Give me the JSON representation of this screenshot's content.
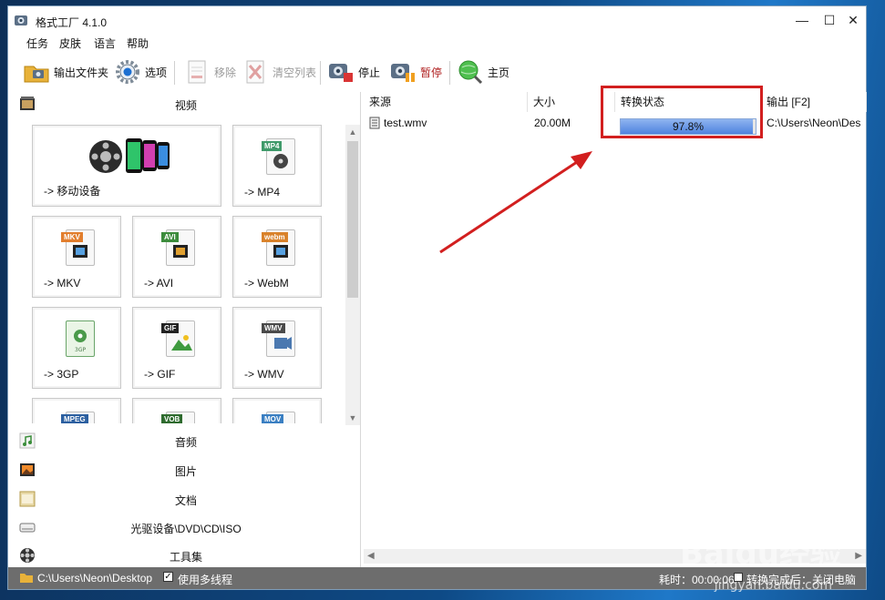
{
  "window": {
    "title": "格式工厂 4.1.0"
  },
  "menu": [
    "任务",
    "皮肤",
    "语言",
    "帮助"
  ],
  "toolbar": {
    "output_folder": "输出文件夹",
    "options": "选项",
    "remove": "移除",
    "clear_list": "清空列表",
    "stop": "停止",
    "pause": "暂停",
    "home": "主页"
  },
  "categories": {
    "video": "视频",
    "audio": "音频",
    "image": "图片",
    "document": "文档",
    "rom": "光驱设备\\DVD\\CD\\ISO",
    "tools": "工具集"
  },
  "video_tiles": [
    {
      "label": "-> 移动设备"
    },
    {
      "label": "-> MP4",
      "tag": "MP4"
    },
    {
      "label": "-> MKV",
      "tag": "MKV"
    },
    {
      "label": "-> AVI",
      "tag": "AVI"
    },
    {
      "label": "-> WebM",
      "tag": "webm"
    },
    {
      "label": "-> 3GP",
      "tag": "3GP"
    },
    {
      "label": "-> GIF",
      "tag": "GIF"
    },
    {
      "label": "-> WMV",
      "tag": "WMV"
    },
    {
      "label": "",
      "tag": "MPEG"
    },
    {
      "label": "",
      "tag": "VOB"
    },
    {
      "label": "",
      "tag": "MOV"
    }
  ],
  "task_table": {
    "columns": [
      "来源",
      "大小",
      "转换状态",
      "输出 [F2]"
    ],
    "rows": [
      {
        "source": "test.wmv",
        "size": "20.00M",
        "status_percent": 97.8,
        "status_text": "97.8%",
        "output": "C:\\Users\\Neon\\Des"
      }
    ]
  },
  "statusbar": {
    "path": "C:\\Users\\Neon\\Desktop",
    "multithread_label": "使用多线程",
    "multithread_checked": true,
    "elapsed_label": "耗时：00:00:06",
    "after_convert": "转换完成后：关闭电脑"
  },
  "watermark": {
    "main": "Baidu经验",
    "sub": "jingyan.baidu.com"
  },
  "colors": {
    "highlight": "#d21f1f",
    "progress": "#4f83df",
    "statusbar": "#6d6d6d"
  }
}
